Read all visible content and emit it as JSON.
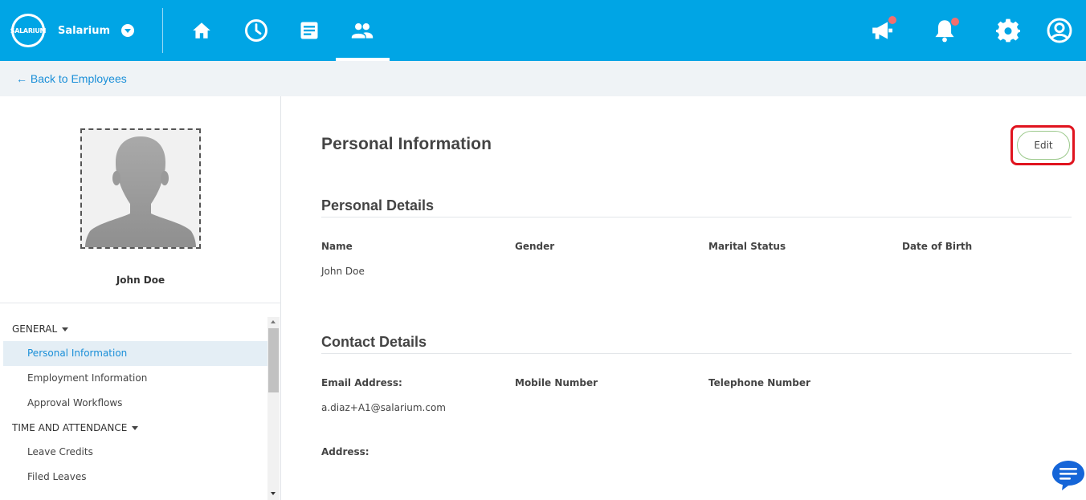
{
  "app": {
    "brand_logo_text": "SALARIUM",
    "company_name": "Salarium"
  },
  "nav": {
    "icons": [
      "home-icon",
      "clock-icon",
      "document-icon",
      "people-icon"
    ],
    "active": "people-icon",
    "right_icons": [
      "megaphone-icon",
      "bell-icon",
      "gear-icon",
      "user-account-icon"
    ]
  },
  "back_link": "← Back to Employees",
  "employee": {
    "name": "John Doe"
  },
  "sidebar": {
    "groups": [
      {
        "label": "GENERAL",
        "items": [
          "Personal Information",
          "Employment Information",
          "Approval Workflows"
        ]
      },
      {
        "label": "TIME AND ATTENDANCE",
        "items": [
          "Leave Credits",
          "Filed Leaves"
        ]
      }
    ],
    "active_item": "Personal Information"
  },
  "main": {
    "title": "Personal Information",
    "edit_label": "Edit",
    "personal_details": {
      "heading": "Personal Details",
      "labels": [
        "Name",
        "Gender",
        "Marital Status",
        "Date of Birth"
      ],
      "values": [
        "John Doe",
        "",
        "",
        ""
      ]
    },
    "contact_details": {
      "heading": "Contact Details",
      "labels": [
        "Email Address:",
        "Mobile Number",
        "Telephone Number"
      ],
      "values": [
        "a.diaz+A1@salarium.com",
        "",
        ""
      ],
      "address_label": "Address:"
    }
  },
  "colors": {
    "topbar": "#00a5e5",
    "link": "#1a8fd8",
    "highlight": "#e0141f",
    "notification_dot": "#f36f6f",
    "chat": "#1565d8"
  }
}
